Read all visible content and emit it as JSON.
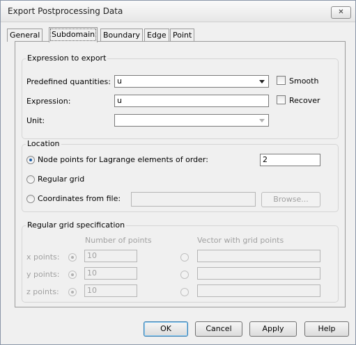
{
  "window": {
    "title": "Export Postprocessing Data",
    "close_icon": "✕"
  },
  "tabs": [
    {
      "label": "General",
      "active": false
    },
    {
      "label": "Subdomain",
      "active": true
    },
    {
      "label": "Boundary",
      "active": false
    },
    {
      "label": "Edge",
      "active": false
    },
    {
      "label": "Point",
      "active": false
    }
  ],
  "expression_group": {
    "title": "Expression to export",
    "predefined_label": "Predefined quantities:",
    "predefined_value": "u",
    "smooth_label": "Smooth",
    "expression_label": "Expression:",
    "expression_value": "u",
    "recover_label": "Recover",
    "unit_label": "Unit:",
    "unit_value": ""
  },
  "location_group": {
    "title": "Location",
    "node_points_label": "Node points for Lagrange elements of order:",
    "order_value": "2",
    "regular_grid_label": "Regular grid",
    "coords_file_label": "Coordinates from file:",
    "coords_file_value": "",
    "browse_label": "Browse..."
  },
  "grid_group": {
    "title": "Regular grid specification",
    "num_points_header": "Number of points",
    "vector_header": "Vector with grid points",
    "rows": [
      {
        "label": "x points:",
        "value": "10"
      },
      {
        "label": "y points:",
        "value": "10"
      },
      {
        "label": "z points:",
        "value": "10"
      }
    ]
  },
  "buttons": {
    "ok": "OK",
    "cancel": "Cancel",
    "apply": "Apply",
    "help": "Help"
  }
}
